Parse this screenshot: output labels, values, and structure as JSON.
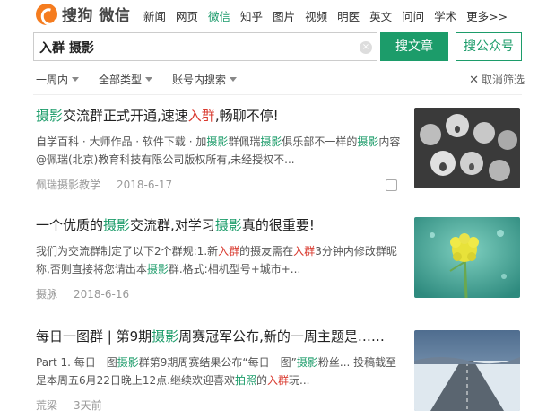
{
  "header": {
    "logo_text": "搜狗 微信",
    "nav_items": [
      "新闻",
      "网页",
      "微信",
      "知乎",
      "图片",
      "视频",
      "明医",
      "英文",
      "问问",
      "学术",
      "更多>>"
    ],
    "active_index": 2
  },
  "search": {
    "query": "入群 摄影",
    "clear_label": "×",
    "submit_label": "搜文章",
    "gzh_label": "搜公众号"
  },
  "filters": {
    "items": [
      "一周内",
      "全部类型",
      "账号内搜索"
    ],
    "clear_label": "取消筛选"
  },
  "results": [
    {
      "title_parts": [
        [
          "摄影",
          "g"
        ],
        [
          "交流群正式开通,速速",
          ""
        ],
        [
          "入群",
          "r"
        ],
        [
          ",畅聊不停!",
          ""
        ]
      ],
      "snippet_parts": [
        [
          "自学百科 · 大师作品 · 软件下载 · 加",
          ""
        ],
        [
          "摄影",
          "g"
        ],
        [
          "群佩瑞",
          ""
        ],
        [
          "摄影",
          "g"
        ],
        [
          "俱乐部不一样的",
          ""
        ],
        [
          "摄影",
          "g"
        ],
        [
          "内容@佩瑞(北京)教育科技有限公司版权所有,未经授权不...",
          ""
        ]
      ],
      "source": "佩瑞摄影教学",
      "date": "2018-6-17"
    },
    {
      "title_parts": [
        [
          "一个优质的",
          ""
        ],
        [
          "摄影",
          "g"
        ],
        [
          "交流群,对学习",
          ""
        ],
        [
          "摄影",
          "g"
        ],
        [
          "真的很重要!",
          ""
        ]
      ],
      "snippet_parts": [
        [
          "我们为交流群制定了以下2个群规:1.新",
          ""
        ],
        [
          "入群",
          "r"
        ],
        [
          "的摄友需在",
          ""
        ],
        [
          "入群",
          "r"
        ],
        [
          "3分钟内修改群昵称,否则直接将您请出本",
          ""
        ],
        [
          "摄影",
          "g"
        ],
        [
          "群.格式:相机型号+城市+...",
          ""
        ]
      ],
      "source": "摄脉",
      "date": "2018-6-16"
    },
    {
      "title_parts": [
        [
          "每日一图群 | 第9期",
          ""
        ],
        [
          "摄影",
          "g"
        ],
        [
          "周赛冠军公布,新的一周主题是……",
          ""
        ]
      ],
      "snippet_parts": [
        [
          "Part 1. 每日一图",
          ""
        ],
        [
          "摄影",
          "g"
        ],
        [
          "群第9期周赛结果公布“每日一图”",
          ""
        ],
        [
          "摄影",
          "g"
        ],
        [
          "粉丝... 投稿截至是本周五6月22日晚上12点.继续欢迎喜欢",
          ""
        ],
        [
          "拍照",
          "g"
        ],
        [
          "的",
          ""
        ],
        [
          "入群",
          "r"
        ],
        [
          "玩...",
          ""
        ]
      ],
      "source": "荒梁",
      "date": "3天前"
    }
  ],
  "colors": {
    "accent": "#1c9c6a",
    "highlight_red": "#d93a2f",
    "logo_orange": "#f57c1f"
  }
}
